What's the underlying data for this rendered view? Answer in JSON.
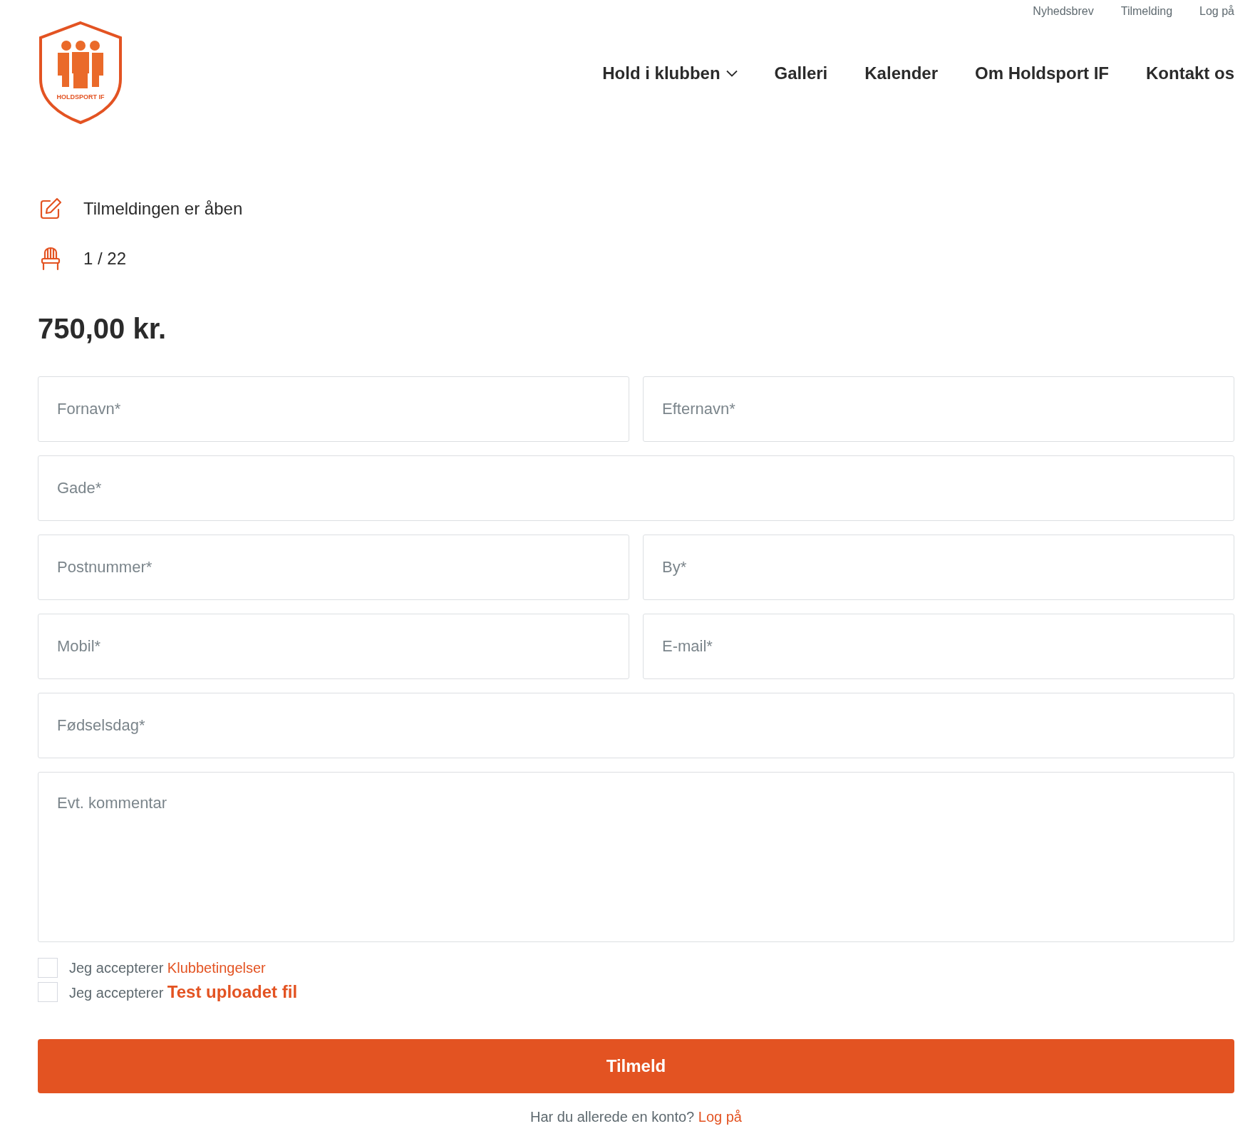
{
  "top_links": [
    "Nyhedsbrev",
    "Tilmelding",
    "Log på"
  ],
  "logo": {
    "text": "HOLDSPORT IF"
  },
  "nav": [
    {
      "label": "Hold i klubben",
      "dropdown": true
    },
    {
      "label": "Galleri",
      "dropdown": false
    },
    {
      "label": "Kalender",
      "dropdown": false
    },
    {
      "label": "Om Holdsport IF",
      "dropdown": false
    },
    {
      "label": "Kontakt os",
      "dropdown": false
    }
  ],
  "info": [
    {
      "kind": "status",
      "text": "Tilmeldingen er åben"
    },
    {
      "kind": "seats",
      "text": "1 / 22"
    }
  ],
  "price": "750,00 kr.",
  "fields": [
    {
      "kind": "half",
      "placeholder": "Fornavn*"
    },
    {
      "kind": "half",
      "placeholder": "Efternavn*"
    },
    {
      "kind": "wide",
      "placeholder": "Gade*"
    },
    {
      "kind": "half",
      "placeholder": "Postnummer*"
    },
    {
      "kind": "half",
      "placeholder": "By*"
    },
    {
      "kind": "half",
      "placeholder": "Mobil*"
    },
    {
      "kind": "half",
      "placeholder": "E-mail*"
    },
    {
      "kind": "wide",
      "placeholder": "Fødselsdag*"
    },
    {
      "kind": "textarea",
      "placeholder": "Evt. kommentar"
    }
  ],
  "terms": [
    {
      "text": "Jeg accepterer",
      "link": "Klubbetingelser",
      "kind": "plain",
      "checked": false
    },
    {
      "text": "Jeg accepterer",
      "link": "Test uploadet fil",
      "kind": "strong",
      "checked": false
    }
  ],
  "submit": "Tilmeld",
  "login_prompt": {
    "text": "Har du allerede en konto?",
    "link": "Log på"
  }
}
